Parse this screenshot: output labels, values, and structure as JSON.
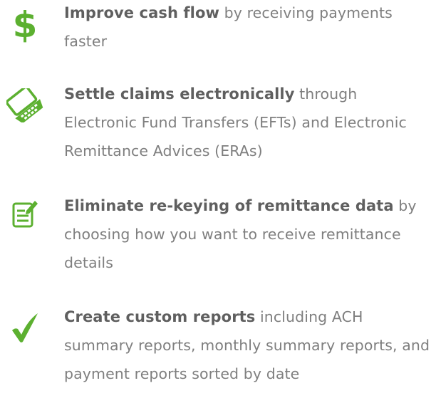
{
  "colors": {
    "icon_green": "#5cb030",
    "heading_text": "#5f5f5f",
    "body_text": "#7f7f7f"
  },
  "benefits": [
    {
      "icon": "dollar-sign-icon",
      "heading": "Improve cash flow",
      "body": " by receiving payments faster"
    },
    {
      "icon": "laptop-icon",
      "heading": "Settle claims electronically",
      "body": " through Electronic Fund Transfers (EFTs) and Electronic Remittance Advices (ERAs)"
    },
    {
      "icon": "edit-document-icon",
      "heading": "Eliminate re-keying of remittance data",
      "body": " by choosing how you want to receive remittance details"
    },
    {
      "icon": "checkmark-icon",
      "heading": "Create custom reports",
      "body": " including ACH summary reports, monthly summary reports, and payment reports sorted by date"
    }
  ]
}
